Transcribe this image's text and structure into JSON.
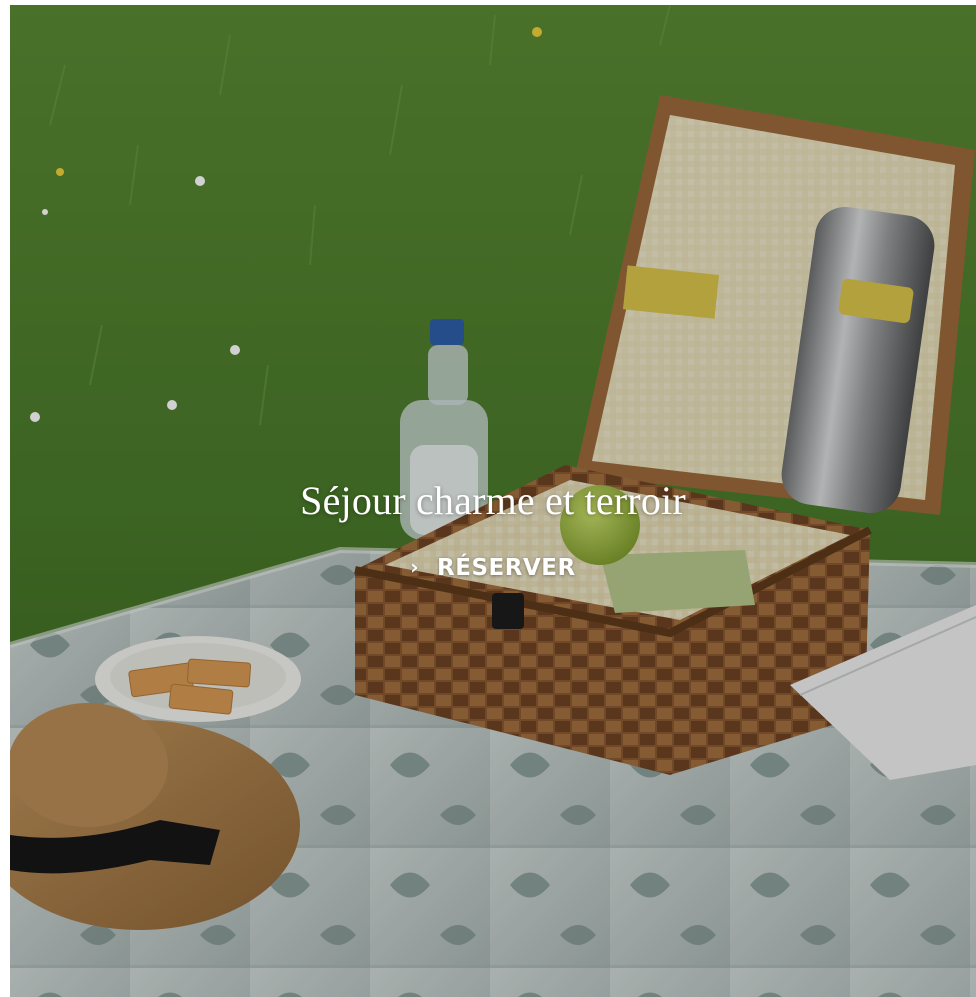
{
  "hero": {
    "title": "Séjour charme et terroir",
    "cta_label": "RÉSERVER",
    "cta_icon": "chevron-right-icon"
  },
  "colors": {
    "text": "#ffffff",
    "grass": "#4e7a2c",
    "blanket": "#c9d2d0",
    "basket": "#8a5a32"
  }
}
